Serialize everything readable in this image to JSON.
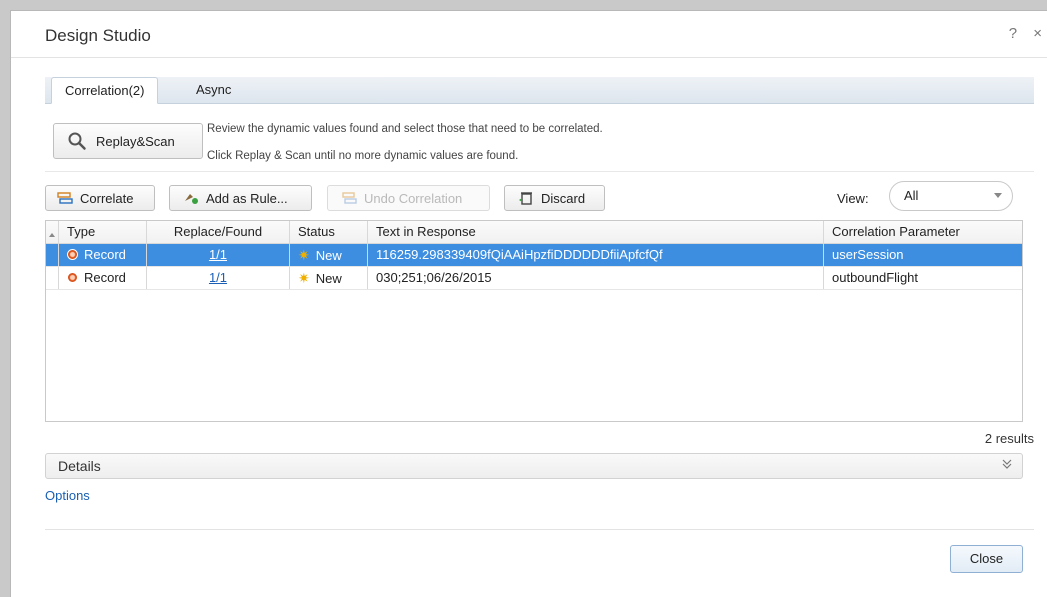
{
  "dialog": {
    "title": "Design Studio",
    "help_label": "?",
    "close_glyph": "×"
  },
  "tabs": [
    {
      "label": "Correlation(2)",
      "active": true
    },
    {
      "label": "Async",
      "active": false
    }
  ],
  "scan": {
    "button_label": "Replay&Scan",
    "hint_line1": "Review the dynamic values found and select those that need to be correlated.",
    "hint_line2": "Click Replay & Scan until no more dynamic values are found."
  },
  "toolbar": {
    "correlate_label": "Correlate",
    "add_rule_label": "Add as Rule...",
    "undo_label": "Undo Correlation",
    "discard_label": "Discard",
    "view_label": "View:",
    "view_value": "All"
  },
  "grid": {
    "columns": [
      "Type",
      "Replace/Found",
      "Status",
      "Text in Response",
      "Correlation Parameter"
    ],
    "rows": [
      {
        "type": "Record",
        "replace_found": "1/1",
        "status": "New",
        "text": "116259.298339409fQiAAiHpzfiDDDDDDfiiApfcfQf",
        "param": "userSession",
        "selected": true
      },
      {
        "type": "Record",
        "replace_found": "1/1",
        "status": "New",
        "text": "030;251;06/26/2015",
        "param": "outboundFlight",
        "selected": false
      }
    ],
    "results_text": "2 results"
  },
  "details": {
    "label": "Details",
    "chevron": "»"
  },
  "options_link": "Options",
  "close_button": "Close",
  "colors": {
    "selection": "#3d8ee0",
    "link": "#1a5fb4",
    "record_icon": "#e0581e",
    "star": "#f0b000"
  }
}
